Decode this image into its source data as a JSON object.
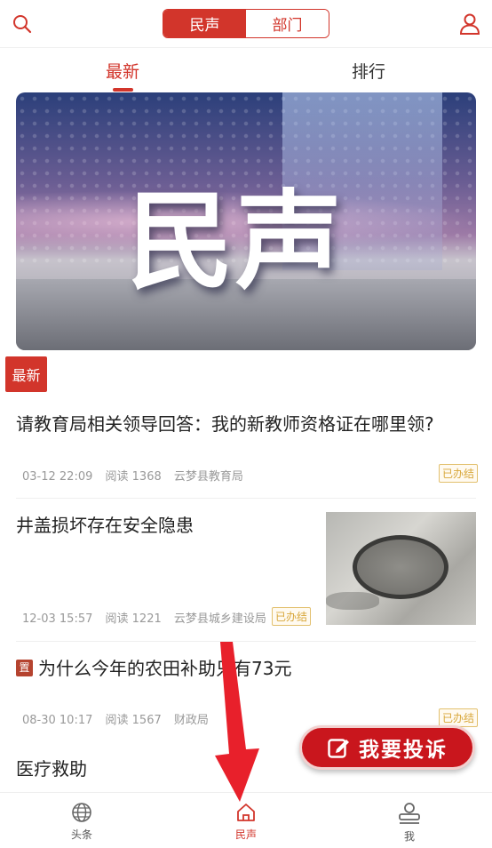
{
  "header": {
    "segments": [
      "民声",
      "部门"
    ],
    "active_segment": "民声",
    "icons": {
      "left": "search-icon",
      "right": "user-icon"
    }
  },
  "tabs": [
    {
      "label": "最新",
      "active": true
    },
    {
      "label": "排行",
      "active": false
    }
  ],
  "banner": {
    "title": "民声"
  },
  "section_badge": "最新",
  "posts": [
    {
      "title": "请教育局相关领导回答：我的新教师资格证在哪里领?",
      "date": "03-12 22:09",
      "reads": "阅读 1368",
      "department": "云梦县教育局",
      "status": "已办结"
    },
    {
      "title": "井盖损坏存在安全隐患",
      "date": "12-03 15:57",
      "reads": "阅读 1221",
      "department": "云梦县城乡建设局",
      "status": "已办结",
      "has_thumbnail": true
    },
    {
      "tag": "置",
      "title": "为什么今年的农田补助只有73元",
      "date": "08-30 10:17",
      "reads": "阅读 1567",
      "department": "财政局",
      "status": "已办结"
    },
    {
      "title": "医疗救助"
    }
  ],
  "fab": {
    "label": "我要投诉",
    "icon": "edit-icon"
  },
  "bottom_nav": [
    {
      "label": "头条",
      "icon": "globe-icon",
      "active": false
    },
    {
      "label": "民声",
      "icon": "home-icon",
      "active": true
    },
    {
      "label": "我",
      "icon": "person-icon",
      "active": false
    }
  ],
  "colors": {
    "accent": "#d2352b",
    "status": "#d8a73a",
    "fab": "#c9161d"
  }
}
